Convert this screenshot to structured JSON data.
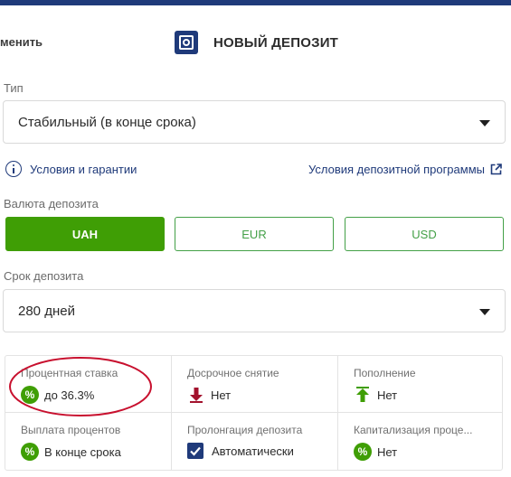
{
  "header": {
    "back_label": "менить",
    "title": "НОВЫЙ ДЕПОЗИТ",
    "title_icon": "safe-icon"
  },
  "type_field": {
    "label": "Тип",
    "value": "Стабильный (в конце срока)"
  },
  "links": {
    "conditions": "Условия и гарантии",
    "program": "Условия депозитной программы"
  },
  "currency": {
    "label": "Валюта депозита",
    "options": [
      "UAH",
      "EUR",
      "USD"
    ],
    "selected": "UAH"
  },
  "term_field": {
    "label": "Срок депозита",
    "value": "280 дней"
  },
  "details": [
    {
      "label": "Процентная ставка",
      "value": "до 36.3%",
      "icon": "percent-icon"
    },
    {
      "label": "Досрочное снятие",
      "value": "Нет",
      "icon": "arrow-down-icon"
    },
    {
      "label": "Пополнение",
      "value": "Нет",
      "icon": "arrow-up-icon"
    },
    {
      "label": "Выплата процентов",
      "value": "В конце срока",
      "icon": "percent-icon"
    },
    {
      "label": "Пролонгация депозита",
      "value": "Автоматически",
      "icon": "check-icon"
    },
    {
      "label": "Капитализация проце...",
      "value": "Нет",
      "icon": "percent-icon"
    }
  ],
  "colors": {
    "brand": "#1f3a7a",
    "accent_green": "#3f9e05",
    "down_arrow": "#a3122d",
    "up_arrow": "#3f9e05",
    "annotation": "#c8102e"
  }
}
